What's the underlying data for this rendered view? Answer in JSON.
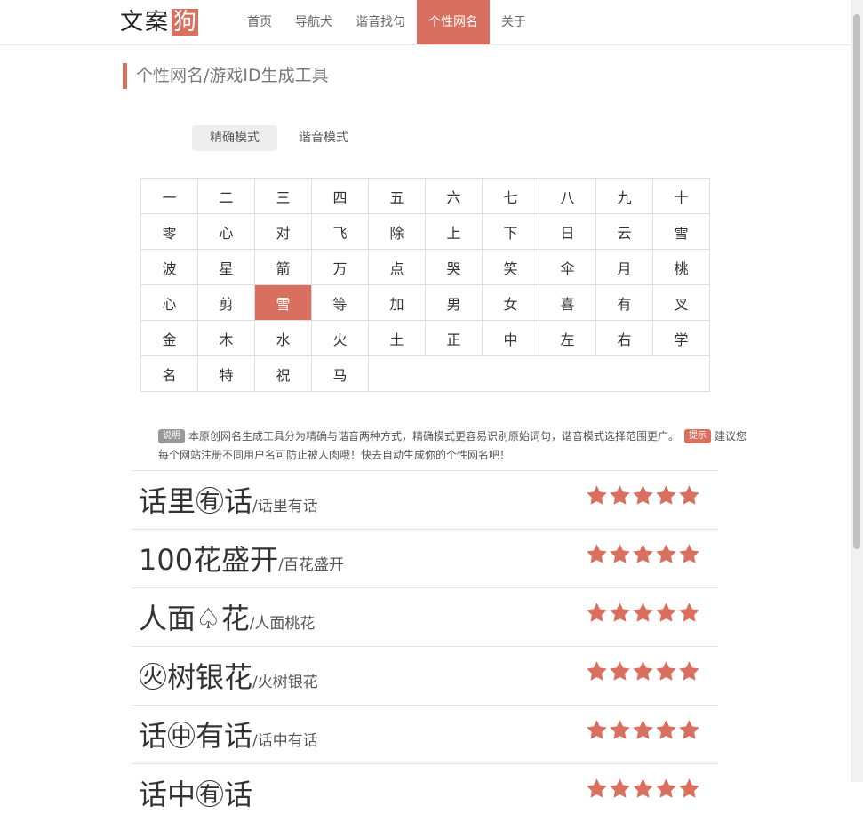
{
  "site": {
    "logo_text": "文案",
    "logo_highlight": "狗"
  },
  "nav": [
    {
      "label": "首页",
      "active": false
    },
    {
      "label": "导航犬",
      "active": false
    },
    {
      "label": "谐音找句",
      "active": false
    },
    {
      "label": "个性网名",
      "active": true
    },
    {
      "label": "关于",
      "active": false
    }
  ],
  "page": {
    "title": "个性网名/游戏ID生成工具"
  },
  "modes": [
    {
      "label": "精确模式",
      "active": true
    },
    {
      "label": "谐音模式",
      "active": false
    }
  ],
  "grid": {
    "rows": [
      [
        "一",
        "二",
        "三",
        "四",
        "五",
        "六",
        "七",
        "八",
        "九",
        "十"
      ],
      [
        "零",
        "心",
        "对",
        "飞",
        "除",
        "上",
        "下",
        "日",
        "云",
        "雪"
      ],
      [
        "波",
        "星",
        "箭",
        "万",
        "点",
        "哭",
        "笑",
        "伞",
        "月",
        "桃"
      ],
      [
        "心",
        "剪",
        "雪",
        "等",
        "加",
        "男",
        "女",
        "喜",
        "有",
        "叉"
      ],
      [
        "金",
        "木",
        "水",
        "火",
        "土",
        "正",
        "中",
        "左",
        "右",
        "学"
      ],
      [
        "名",
        "特",
        "祝",
        "马"
      ]
    ],
    "selected": "雪"
  },
  "notes": {
    "badge1": "说明",
    "text1": "本原创网名生成工具分为精确与谐音两种方式，精确模式更容易识别原始词句，谐音模式选择范围更广。",
    "badge2": "提示",
    "text2": "建议您每个网站注册不同用户名可防止被人肉哦！快去自动生成你的个性网名吧！"
  },
  "results": [
    {
      "name": "话里㊒话",
      "original": "/话里有话",
      "stars": 5
    },
    {
      "name": "100花盛开",
      "original": "/百花盛开",
      "stars": 5
    },
    {
      "name": "人面♤花",
      "original": "/人面桃花",
      "stars": 5
    },
    {
      "name": "㊋树银花",
      "original": "/火树银花",
      "stars": 5
    },
    {
      "name": "话㊥有话",
      "original": "/话中有话",
      "stars": 5
    },
    {
      "name": "话中㊒话",
      "original": "",
      "stars": 5
    }
  ],
  "colors": {
    "accent": "#d9705f"
  },
  "icons": {
    "star": "star-icon"
  }
}
